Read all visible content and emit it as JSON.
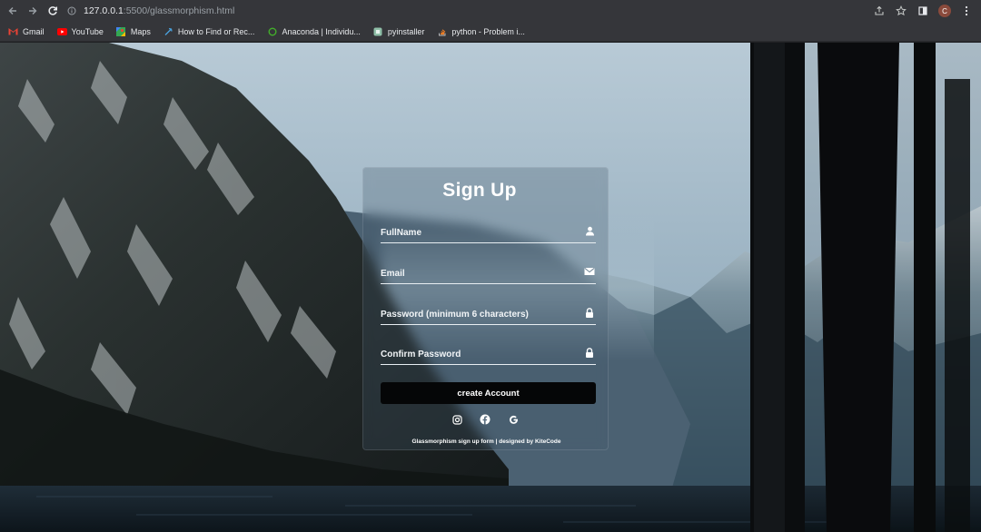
{
  "browser": {
    "url_host": "127.0.0.1",
    "url_path": ":5500/glassmorphism.html",
    "profile_initial": "C"
  },
  "bookmarks": [
    {
      "label": "Gmail",
      "icon": "gmail-icon",
      "color": "#ea4335"
    },
    {
      "label": "YouTube",
      "icon": "youtube-icon",
      "color": "#ff0000"
    },
    {
      "label": "Maps",
      "icon": "maps-icon",
      "color": "#34a853"
    },
    {
      "label": "How to Find or Rec...",
      "icon": "bookmark-site-icon",
      "color": "#4aa3df"
    },
    {
      "label": "Anaconda | Individu...",
      "icon": "anaconda-icon",
      "color": "#43b02a"
    },
    {
      "label": "pyinstaller",
      "icon": "pyinstaller-icon",
      "color": "#8fbfa8"
    },
    {
      "label": "python - Problem i...",
      "icon": "stackoverflow-icon",
      "color": "#f48024"
    }
  ],
  "form": {
    "title": "Sign Up",
    "fields": [
      {
        "placeholder": "FullName",
        "icon": "user-icon",
        "value": ""
      },
      {
        "placeholder": "Email",
        "icon": "envelope-icon",
        "value": ""
      },
      {
        "placeholder": "Password (minimum 6 characters)",
        "icon": "lock-icon",
        "value": ""
      },
      {
        "placeholder": "Confirm Password",
        "icon": "lock-icon",
        "value": ""
      }
    ],
    "submit_label": "create Account",
    "socials": [
      "instagram-icon",
      "facebook-icon",
      "google-icon"
    ],
    "footer": "Glassmorphism sign up form | designed by KiteCode"
  }
}
